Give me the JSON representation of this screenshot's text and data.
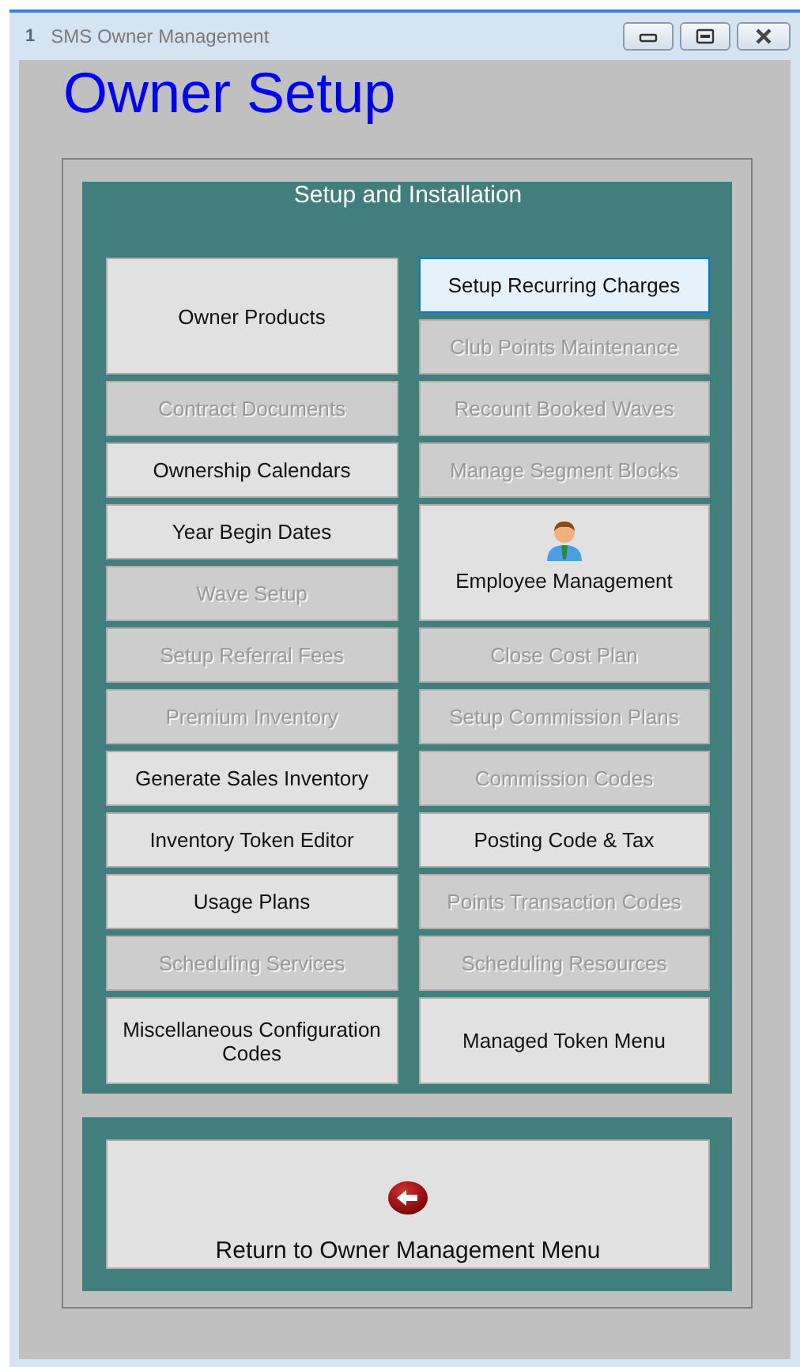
{
  "window": {
    "badge": "1",
    "title": "SMS Owner Management"
  },
  "heading": "Owner Setup",
  "panel": {
    "title": "Setup and Installation",
    "columns": [
      [
        {
          "label": "Owner Products",
          "kind": "large",
          "disabled": false,
          "selected": false
        },
        {
          "label": "Contract Documents",
          "kind": "standard",
          "disabled": true,
          "selected": false
        },
        {
          "label": "Ownership Calendars",
          "kind": "standard",
          "disabled": false,
          "selected": false
        },
        {
          "label": "Year Begin Dates",
          "kind": "standard",
          "disabled": false,
          "selected": false
        },
        {
          "label": "Wave Setup",
          "kind": "standard",
          "disabled": true,
          "selected": false
        },
        {
          "label": "Setup Referral Fees",
          "kind": "standard",
          "disabled": true,
          "selected": false
        },
        {
          "label": "Premium Inventory",
          "kind": "standard",
          "disabled": true,
          "selected": false
        },
        {
          "label": "Generate Sales Inventory",
          "kind": "standard",
          "disabled": false,
          "selected": false
        },
        {
          "label": "Inventory Token Editor",
          "kind": "standard",
          "disabled": false,
          "selected": false
        },
        {
          "label": "Usage Plans",
          "kind": "standard",
          "disabled": false,
          "selected": false
        },
        {
          "label": "Scheduling Services",
          "kind": "standard",
          "disabled": true,
          "selected": false
        },
        {
          "label": "Miscellaneous Configuration Codes",
          "kind": "tall",
          "disabled": false,
          "selected": false
        }
      ],
      [
        {
          "label": "Setup Recurring Charges",
          "kind": "standard",
          "disabled": false,
          "selected": true
        },
        {
          "label": "Club Points Maintenance",
          "kind": "standard",
          "disabled": true,
          "selected": false
        },
        {
          "label": "Recount Booked Waves",
          "kind": "standard",
          "disabled": true,
          "selected": false
        },
        {
          "label": "Manage Segment Blocks",
          "kind": "standard",
          "disabled": true,
          "selected": false
        },
        {
          "label": "Employee Management",
          "kind": "icon",
          "disabled": false,
          "selected": false
        },
        {
          "label": "Close Cost Plan",
          "kind": "standard",
          "disabled": true,
          "selected": false
        },
        {
          "label": "Setup Commission Plans",
          "kind": "standard",
          "disabled": true,
          "selected": false
        },
        {
          "label": "Commission Codes",
          "kind": "standard",
          "disabled": true,
          "selected": false
        },
        {
          "label": "Posting Code & Tax",
          "kind": "standard",
          "disabled": false,
          "selected": false
        },
        {
          "label": "Points Transaction Codes",
          "kind": "standard",
          "disabled": true,
          "selected": false
        },
        {
          "label": "Scheduling Resources",
          "kind": "standard",
          "disabled": true,
          "selected": false
        },
        {
          "label": "Managed Token Menu",
          "kind": "tall",
          "disabled": false,
          "selected": false
        }
      ]
    ]
  },
  "return_button": {
    "label": "Return to Owner Management Menu"
  }
}
